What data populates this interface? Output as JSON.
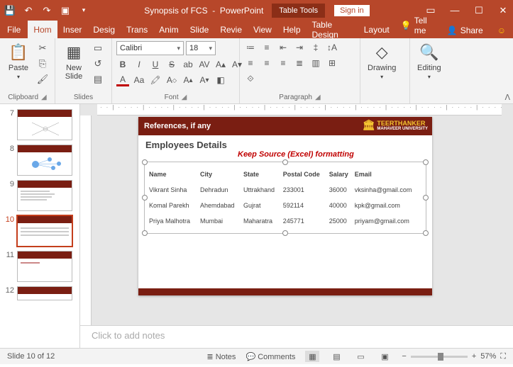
{
  "title": {
    "doc": "Synopsis of FCS",
    "app": "PowerPoint",
    "context": "Table Tools",
    "signin": "Sign in"
  },
  "tabs": {
    "file": "File",
    "home": "Hom",
    "insert": "Inser",
    "design": "Desig",
    "trans": "Trans",
    "anim": "Anim",
    "slide": "Slide",
    "review": "Revie",
    "view": "View",
    "help": "Help",
    "tdesign": "Table Design",
    "layout": "Layout",
    "tellme": "Tell me",
    "share": "Share"
  },
  "ribbon": {
    "clipboard": {
      "title": "Clipboard",
      "paste": "Paste"
    },
    "slides": {
      "title": "Slides",
      "new": "New\nSlide"
    },
    "font": {
      "title": "Font",
      "name": "Calibri",
      "size": "18"
    },
    "paragraph": {
      "title": "Paragraph"
    },
    "drawing": {
      "title": "Drawing"
    },
    "editing": {
      "title": "Editing"
    }
  },
  "thumbs": [
    "7",
    "8",
    "9",
    "10",
    "11",
    "12"
  ],
  "selected_thumb": "10",
  "slide": {
    "ref": "References, if any",
    "uni1": "TEERTHANKER",
    "uni2": "MAHAVEER UNIVERSITY",
    "heading": "Employees Details",
    "note": "Keep Source (Excel) formatting",
    "cols": [
      "Name",
      "City",
      "State",
      "Postal Code",
      "Salary",
      "Email"
    ],
    "rows": [
      [
        "Vikrant Sinha",
        "Dehradun",
        "Uttrakhand",
        "233001",
        "36000",
        "vksinha@gmail.com"
      ],
      [
        "Komal Parekh",
        "Ahemdabad",
        "Gujrat",
        "592114",
        "40000",
        "kpk@gmail.com"
      ],
      [
        "Priya Malhotra",
        "Mumbai",
        "Maharatra",
        "245771",
        "25000",
        "priyam@gmail.com"
      ]
    ]
  },
  "notes_placeholder": "Click to add notes",
  "status": {
    "slide": "Slide 10 of 12",
    "notes": "Notes",
    "comments": "Comments",
    "zoom": "57%"
  }
}
